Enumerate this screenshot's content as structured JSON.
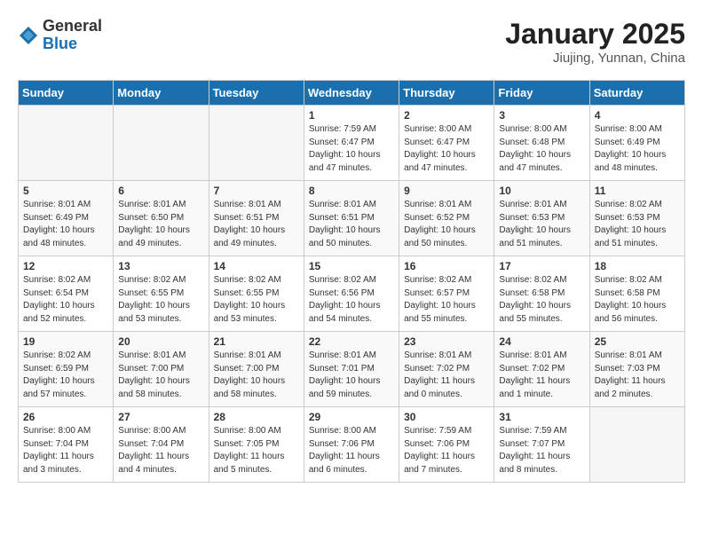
{
  "header": {
    "logo_general": "General",
    "logo_blue": "Blue",
    "title": "January 2025",
    "subtitle": "Jiujing, Yunnan, China"
  },
  "weekdays": [
    "Sunday",
    "Monday",
    "Tuesday",
    "Wednesday",
    "Thursday",
    "Friday",
    "Saturday"
  ],
  "weeks": [
    [
      {
        "day": "",
        "info": ""
      },
      {
        "day": "",
        "info": ""
      },
      {
        "day": "",
        "info": ""
      },
      {
        "day": "1",
        "info": "Sunrise: 7:59 AM\nSunset: 6:47 PM\nDaylight: 10 hours\nand 47 minutes."
      },
      {
        "day": "2",
        "info": "Sunrise: 8:00 AM\nSunset: 6:47 PM\nDaylight: 10 hours\nand 47 minutes."
      },
      {
        "day": "3",
        "info": "Sunrise: 8:00 AM\nSunset: 6:48 PM\nDaylight: 10 hours\nand 47 minutes."
      },
      {
        "day": "4",
        "info": "Sunrise: 8:00 AM\nSunset: 6:49 PM\nDaylight: 10 hours\nand 48 minutes."
      }
    ],
    [
      {
        "day": "5",
        "info": "Sunrise: 8:01 AM\nSunset: 6:49 PM\nDaylight: 10 hours\nand 48 minutes."
      },
      {
        "day": "6",
        "info": "Sunrise: 8:01 AM\nSunset: 6:50 PM\nDaylight: 10 hours\nand 49 minutes."
      },
      {
        "day": "7",
        "info": "Sunrise: 8:01 AM\nSunset: 6:51 PM\nDaylight: 10 hours\nand 49 minutes."
      },
      {
        "day": "8",
        "info": "Sunrise: 8:01 AM\nSunset: 6:51 PM\nDaylight: 10 hours\nand 50 minutes."
      },
      {
        "day": "9",
        "info": "Sunrise: 8:01 AM\nSunset: 6:52 PM\nDaylight: 10 hours\nand 50 minutes."
      },
      {
        "day": "10",
        "info": "Sunrise: 8:01 AM\nSunset: 6:53 PM\nDaylight: 10 hours\nand 51 minutes."
      },
      {
        "day": "11",
        "info": "Sunrise: 8:02 AM\nSunset: 6:53 PM\nDaylight: 10 hours\nand 51 minutes."
      }
    ],
    [
      {
        "day": "12",
        "info": "Sunrise: 8:02 AM\nSunset: 6:54 PM\nDaylight: 10 hours\nand 52 minutes."
      },
      {
        "day": "13",
        "info": "Sunrise: 8:02 AM\nSunset: 6:55 PM\nDaylight: 10 hours\nand 53 minutes."
      },
      {
        "day": "14",
        "info": "Sunrise: 8:02 AM\nSunset: 6:55 PM\nDaylight: 10 hours\nand 53 minutes."
      },
      {
        "day": "15",
        "info": "Sunrise: 8:02 AM\nSunset: 6:56 PM\nDaylight: 10 hours\nand 54 minutes."
      },
      {
        "day": "16",
        "info": "Sunrise: 8:02 AM\nSunset: 6:57 PM\nDaylight: 10 hours\nand 55 minutes."
      },
      {
        "day": "17",
        "info": "Sunrise: 8:02 AM\nSunset: 6:58 PM\nDaylight: 10 hours\nand 55 minutes."
      },
      {
        "day": "18",
        "info": "Sunrise: 8:02 AM\nSunset: 6:58 PM\nDaylight: 10 hours\nand 56 minutes."
      }
    ],
    [
      {
        "day": "19",
        "info": "Sunrise: 8:02 AM\nSunset: 6:59 PM\nDaylight: 10 hours\nand 57 minutes."
      },
      {
        "day": "20",
        "info": "Sunrise: 8:01 AM\nSunset: 7:00 PM\nDaylight: 10 hours\nand 58 minutes."
      },
      {
        "day": "21",
        "info": "Sunrise: 8:01 AM\nSunset: 7:00 PM\nDaylight: 10 hours\nand 58 minutes."
      },
      {
        "day": "22",
        "info": "Sunrise: 8:01 AM\nSunset: 7:01 PM\nDaylight: 10 hours\nand 59 minutes."
      },
      {
        "day": "23",
        "info": "Sunrise: 8:01 AM\nSunset: 7:02 PM\nDaylight: 11 hours\nand 0 minutes."
      },
      {
        "day": "24",
        "info": "Sunrise: 8:01 AM\nSunset: 7:02 PM\nDaylight: 11 hours\nand 1 minute."
      },
      {
        "day": "25",
        "info": "Sunrise: 8:01 AM\nSunset: 7:03 PM\nDaylight: 11 hours\nand 2 minutes."
      }
    ],
    [
      {
        "day": "26",
        "info": "Sunrise: 8:00 AM\nSunset: 7:04 PM\nDaylight: 11 hours\nand 3 minutes."
      },
      {
        "day": "27",
        "info": "Sunrise: 8:00 AM\nSunset: 7:04 PM\nDaylight: 11 hours\nand 4 minutes."
      },
      {
        "day": "28",
        "info": "Sunrise: 8:00 AM\nSunset: 7:05 PM\nDaylight: 11 hours\nand 5 minutes."
      },
      {
        "day": "29",
        "info": "Sunrise: 8:00 AM\nSunset: 7:06 PM\nDaylight: 11 hours\nand 6 minutes."
      },
      {
        "day": "30",
        "info": "Sunrise: 7:59 AM\nSunset: 7:06 PM\nDaylight: 11 hours\nand 7 minutes."
      },
      {
        "day": "31",
        "info": "Sunrise: 7:59 AM\nSunset: 7:07 PM\nDaylight: 11 hours\nand 8 minutes."
      },
      {
        "day": "",
        "info": ""
      }
    ]
  ]
}
